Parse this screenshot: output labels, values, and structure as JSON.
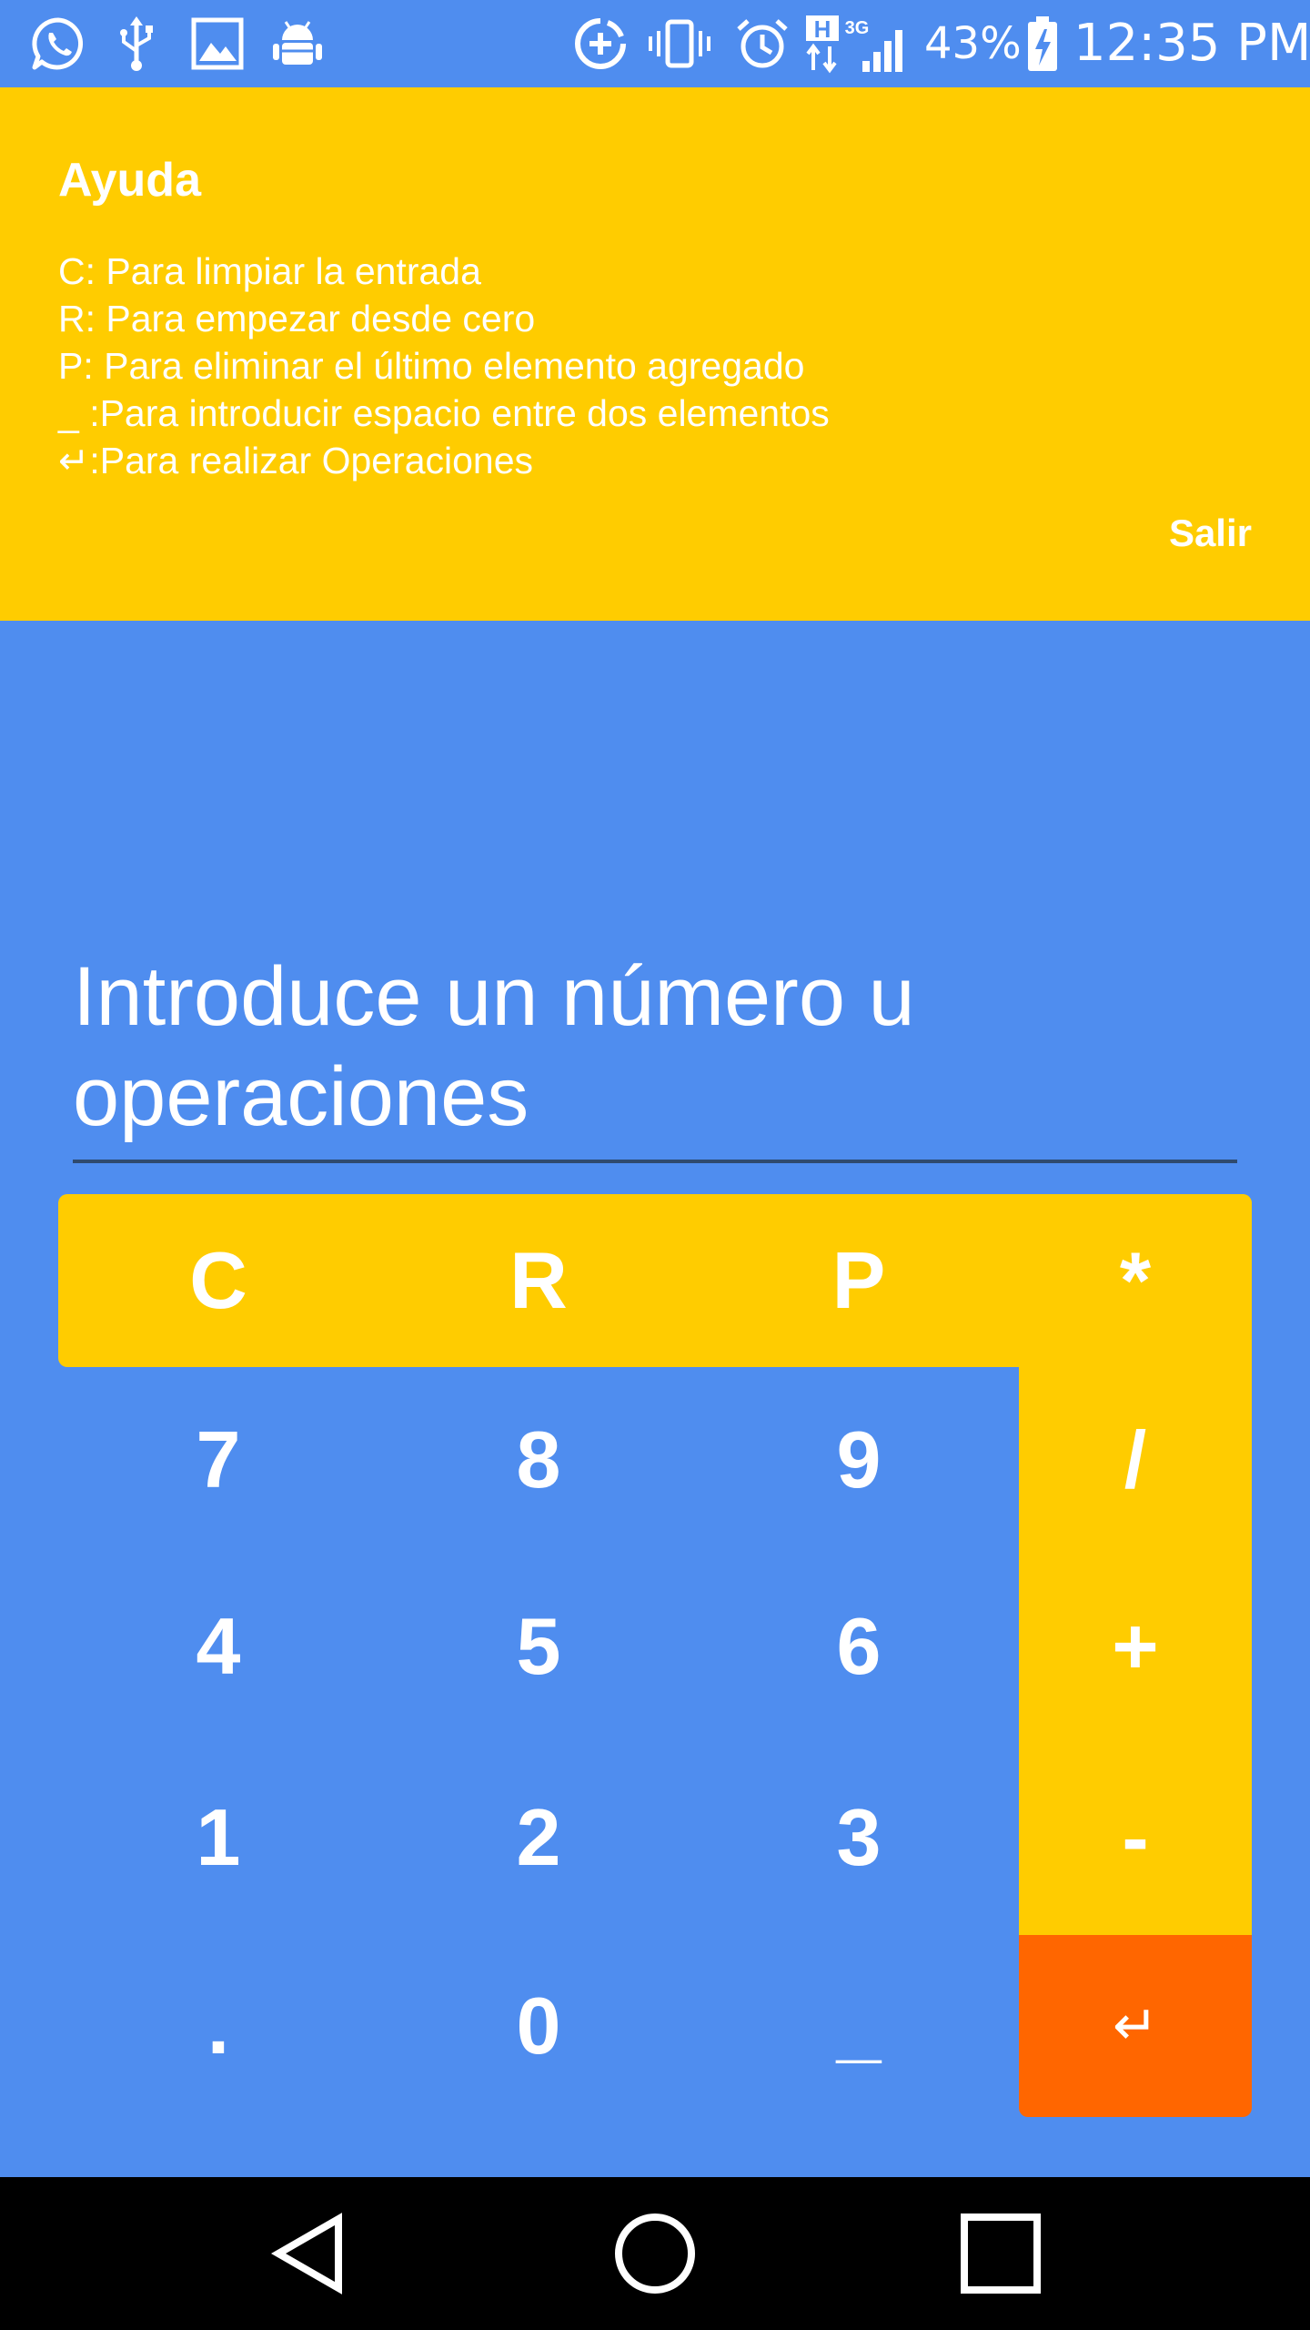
{
  "status_bar": {
    "left_icons": [
      "whatsapp-icon",
      "usb-icon",
      "gallery-icon",
      "android-debug-icon"
    ],
    "right_icons": [
      "data-saver-icon",
      "vibrate-icon",
      "alarm-icon",
      "network-h-3g-icon",
      "signal-icon"
    ],
    "network_h": "H",
    "network_3g": "3G",
    "battery": "43%",
    "battery_icon": "battery-charging-icon",
    "time": "12:35 PM"
  },
  "help": {
    "title": "Ayuda",
    "lines": [
      "C: Para limpiar la entrada",
      "R: Para empezar desde cero",
      "P: Para eliminar el último elemento agregado",
      "_ :Para introducir espacio entre dos elementos",
      "↵:Para realizar Operaciones"
    ],
    "exit_label": "Salir"
  },
  "input": {
    "placeholder": "Introduce un número u operaciones"
  },
  "keypad": {
    "row0": [
      "C",
      "R",
      "P",
      "*"
    ],
    "row1": [
      "7",
      "8",
      "9",
      "/"
    ],
    "row2": [
      "4",
      "5",
      "6",
      "+"
    ],
    "row3": [
      "1",
      "2",
      "3",
      "-"
    ],
    "row4": [
      ".",
      "0",
      "_",
      "↵"
    ]
  },
  "nav_bar": {
    "icons": [
      "back-icon",
      "home-icon",
      "recents-icon"
    ]
  },
  "colors": {
    "background": "#4f8def",
    "accent_yellow": "#ffcc00",
    "enter_orange": "#ff6600",
    "nav_black": "#000000",
    "text": "#ffffff"
  }
}
